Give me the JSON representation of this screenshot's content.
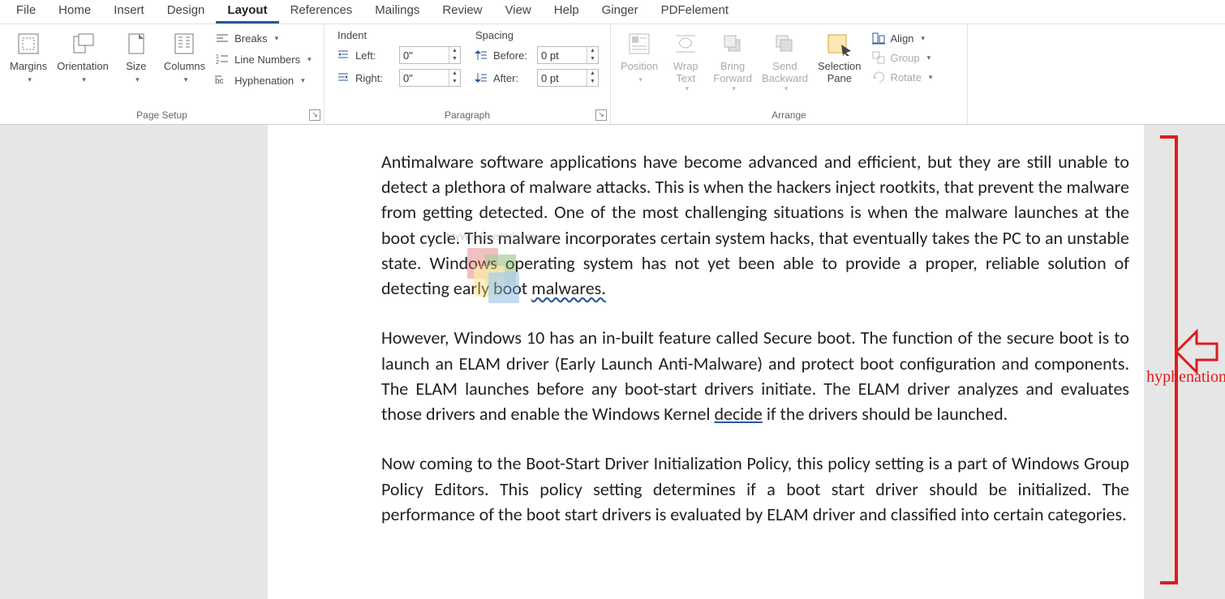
{
  "tabs": {
    "file": "File",
    "home": "Home",
    "insert": "Insert",
    "design": "Design",
    "layout": "Layout",
    "references": "References",
    "mailings": "Mailings",
    "review": "Review",
    "view": "View",
    "help": "Help",
    "ginger": "Ginger",
    "pdfelement": "PDFelement"
  },
  "groups": {
    "page_setup": {
      "label": "Page Setup",
      "margins": "Margins",
      "orientation": "Orientation",
      "size": "Size",
      "columns": "Columns",
      "breaks": "Breaks",
      "line_numbers": "Line Numbers",
      "hyphenation": "Hyphenation"
    },
    "paragraph": {
      "label": "Paragraph",
      "indent_hdr": "Indent",
      "spacing_hdr": "Spacing",
      "left_label": "Left:",
      "right_label": "Right:",
      "before_label": "Before:",
      "after_label": "After:",
      "left_val": "0\"",
      "right_val": "0\"",
      "before_val": "0 pt",
      "after_val": "0 pt"
    },
    "arrange": {
      "label": "Arrange",
      "position": "Position",
      "wrap_text": "Wrap\nText",
      "bring_forward": "Bring\nForward",
      "send_backward": "Send\nBackward",
      "selection_pane": "Selection\nPane",
      "align": "Align",
      "group": "Group",
      "rotate": "Rotate"
    }
  },
  "watermark": {
    "text": "MyWindowsHub.com",
    "c1": "#e06666",
    "c2": "#6aa84f",
    "c3": "#ffd966",
    "c4": "#6fa8dc"
  },
  "document": {
    "p1": "Antimalware software applications have become advanced and efficient, but they are still unable to detect a plethora of malware attacks. This is when the hackers inject rootkits, that prevent the malware from getting detected. One of the most challenging situations is when the malware launches at the boot cycle. This malware incorporates certain system hacks, that eventually takes the PC to an unstable state. Windows oper­ating system has not yet been able to provide a proper, reliable solution of detecting early boot ",
    "p1_wavy": "malwares.",
    "p2a": "However, Windows 10 has an in-built feature called Secure boot. The function of the se­cure boot is to launch an ELAM driver (Early Launch Anti-Malware) and protect boot configuration and components. The ELAM launches before any boot-start drivers initi­ate. The ELAM driver analyzes and evaluates those drivers and enable the Windows Kernel ",
    "p2_u": "decide",
    "p2b": " if the drivers should be launched.",
    "p3": "Now coming to the Boot-Start Driver Initialization Policy, this policy setting is a part of Windows Group Policy Editors. This policy setting determines if a boot start driver should be initialized.  The performance of the boot start drivers is evaluated by ELAM driver and classified into certain categories."
  },
  "annotation": {
    "label": "hyphenation"
  }
}
